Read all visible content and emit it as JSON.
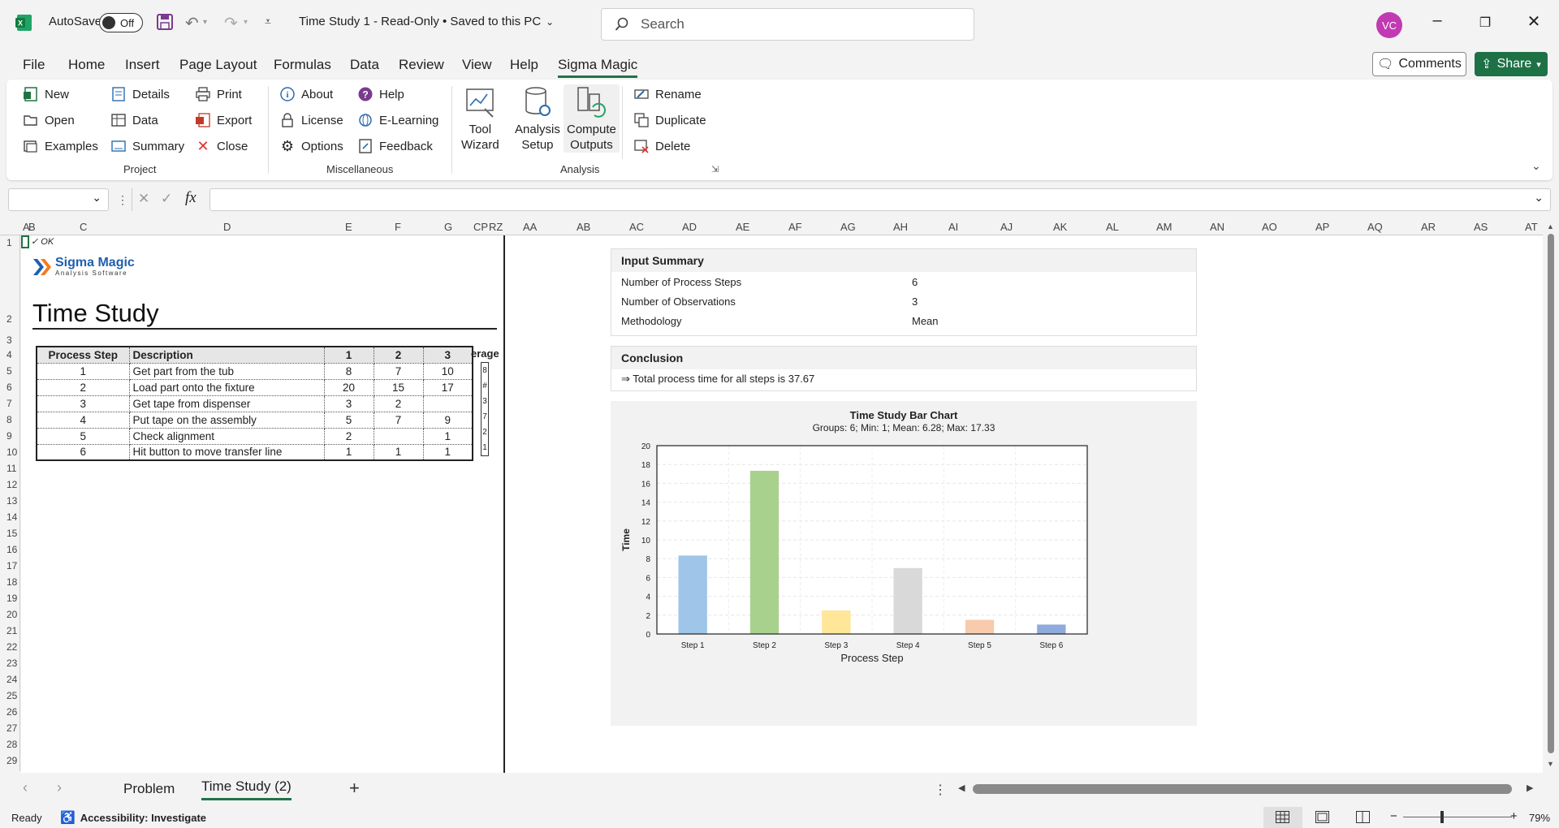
{
  "titlebar": {
    "autosave_label": "AutoSave",
    "autosave_state": "Off",
    "doc_title": "Time Study 1  -  Read-Only • Saved to this PC",
    "search_placeholder": "Search",
    "avatar_initials": "VC"
  },
  "menu": {
    "items": [
      "File",
      "Home",
      "Insert",
      "Page Layout",
      "Formulas",
      "Data",
      "Review",
      "View",
      "Help",
      "Sigma Magic"
    ],
    "active": "Sigma Magic",
    "comments": "Comments",
    "share": "Share"
  },
  "ribbon": {
    "project": {
      "label": "Project",
      "col1": [
        "New",
        "Open",
        "Examples"
      ],
      "col2": [
        "Details",
        "Data",
        "Summary"
      ],
      "col3": [
        "Print",
        "Export",
        "Close"
      ]
    },
    "misc": {
      "label": "Miscellaneous",
      "col1": [
        "About",
        "License",
        "Options"
      ],
      "col2": [
        "Help",
        "E-Learning",
        "Feedback"
      ]
    },
    "analysis": {
      "label": "Analysis",
      "big": [
        {
          "line1": "Tool",
          "line2": "Wizard"
        },
        {
          "line1": "Analysis",
          "line2": "Setup"
        },
        {
          "line1": "Compute",
          "line2": "Outputs"
        }
      ],
      "col": [
        "Rename",
        "Duplicate",
        "Delete"
      ]
    }
  },
  "formula": {
    "fx": "fx",
    "value": ""
  },
  "columns": [
    "A",
    "B",
    "C",
    "D",
    "E",
    "F",
    "G",
    "CP",
    "RZ",
    "AA",
    "AB",
    "AC",
    "AD",
    "AE",
    "AF",
    "AG",
    "AH",
    "AI",
    "AJ",
    "AK",
    "AL",
    "AM",
    "AN",
    "AO",
    "AP",
    "AQ",
    "AR",
    "AS",
    "AT"
  ],
  "rows": [
    "1",
    "2",
    "3",
    "4",
    "5",
    "6",
    "7",
    "8",
    "9",
    "10",
    "11",
    "12",
    "13",
    "14",
    "15",
    "16",
    "17",
    "18",
    "19",
    "20",
    "21",
    "22",
    "23",
    "24",
    "25",
    "26",
    "27",
    "28",
    "29"
  ],
  "sheet": {
    "ok_text": "✓ OK",
    "logo_line1": "Sigma Magic",
    "logo_line2": "Analysis Software",
    "title": "Time Study",
    "table": {
      "headers": [
        "Process Step",
        "Description",
        "1",
        "2",
        "3"
      ],
      "rows": [
        [
          "1",
          "Get part from the tub",
          "8",
          "7",
          "10"
        ],
        [
          "2",
          "Load part onto the fixture",
          "20",
          "15",
          "17"
        ],
        [
          "3",
          "Get tape from dispenser",
          "3",
          "2",
          ""
        ],
        [
          "4",
          "Put tape on the assembly",
          "5",
          "7",
          "9"
        ],
        [
          "5",
          "Check alignment",
          "2",
          "",
          "1"
        ],
        [
          "6",
          "Hit button to move transfer line",
          "1",
          "1",
          "1"
        ]
      ],
      "overflow_header": "erage",
      "overflow_cells": [
        "8",
        "#",
        "3",
        "7",
        "2",
        "1"
      ]
    }
  },
  "input_summary": {
    "title": "Input Summary",
    "rows": [
      {
        "label": "Number of Process Steps",
        "value": "6"
      },
      {
        "label": "Number of Observations",
        "value": "3"
      },
      {
        "label": "Methodology",
        "value": "Mean"
      }
    ]
  },
  "conclusion": {
    "title": "Conclusion",
    "text": "⇒ Total process time for all steps is 37.67"
  },
  "chart_data": {
    "type": "bar",
    "title": "Time Study Bar Chart",
    "subtitle": "Groups: 6; Min: 1; Mean: 6.28; Max: 17.33",
    "xlabel": "Process Step",
    "ylabel": "Time",
    "categories": [
      "Step 1",
      "Step 2",
      "Step 3",
      "Step 4",
      "Step 5",
      "Step 6"
    ],
    "values": [
      8.33,
      17.33,
      2.5,
      7,
      1.5,
      1
    ],
    "colors": [
      "#9fc5e8",
      "#a9d18e",
      "#ffe699",
      "#d9d9d9",
      "#f8cbad",
      "#8faadc"
    ],
    "ylim": [
      0,
      20
    ],
    "yticks": [
      "0",
      "2",
      "4",
      "6",
      "8",
      "10",
      "12",
      "14",
      "16",
      "18",
      "20"
    ],
    "grid": true
  },
  "tabs": {
    "items": [
      "Problem",
      "Time Study (2)"
    ],
    "active": "Time Study (2)",
    "add": "+"
  },
  "status": {
    "ready": "Ready",
    "accessibility": "Accessibility: Investigate",
    "zoom": "79%"
  }
}
